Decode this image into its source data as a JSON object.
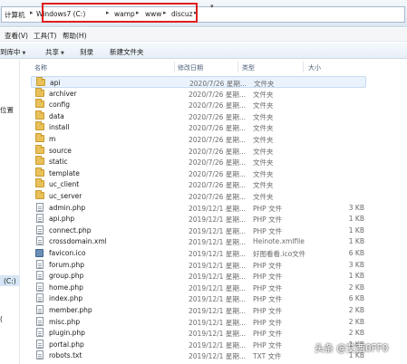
{
  "address": {
    "root": "计算机",
    "segments": [
      "Windows7 (C:)",
      "wamp",
      "www",
      "discuz"
    ]
  },
  "menu": [
    "查看(V)",
    "工具(T)",
    "帮助(H)"
  ],
  "toolbar": {
    "include": "到库中",
    "share": "共享",
    "burn": "刻录",
    "new_folder": "新建文件夹"
  },
  "sidebar": {
    "location": "位置",
    "drive": "(C:)",
    "misc": "("
  },
  "columns": {
    "name": "名称",
    "date": "修改日期",
    "type": "类型",
    "size": "大小"
  },
  "files": [
    {
      "name": "api",
      "date": "2020/7/26 星期...",
      "type": "文件夹",
      "size": "",
      "icon": "folder"
    },
    {
      "name": "archiver",
      "date": "2020/7/26 星期...",
      "type": "文件夹",
      "size": "",
      "icon": "folder"
    },
    {
      "name": "config",
      "date": "2020/7/26 星期...",
      "type": "文件夹",
      "size": "",
      "icon": "folder"
    },
    {
      "name": "data",
      "date": "2020/7/26 星期...",
      "type": "文件夹",
      "size": "",
      "icon": "folder"
    },
    {
      "name": "install",
      "date": "2020/7/26 星期...",
      "type": "文件夹",
      "size": "",
      "icon": "folder"
    },
    {
      "name": "m",
      "date": "2020/7/26 星期...",
      "type": "文件夹",
      "size": "",
      "icon": "folder"
    },
    {
      "name": "source",
      "date": "2020/7/26 星期...",
      "type": "文件夹",
      "size": "",
      "icon": "folder"
    },
    {
      "name": "static",
      "date": "2020/7/26 星期...",
      "type": "文件夹",
      "size": "",
      "icon": "folder"
    },
    {
      "name": "template",
      "date": "2020/7/26 星期...",
      "type": "文件夹",
      "size": "",
      "icon": "folder"
    },
    {
      "name": "uc_client",
      "date": "2020/7/26 星期...",
      "type": "文件夹",
      "size": "",
      "icon": "folder"
    },
    {
      "name": "uc_server",
      "date": "2020/7/26 星期...",
      "type": "文件夹",
      "size": "",
      "icon": "folder"
    },
    {
      "name": "admin.php",
      "date": "2019/12/1 星期...",
      "type": "PHP 文件",
      "size": "3 KB",
      "icon": "doc"
    },
    {
      "name": "api.php",
      "date": "2019/12/1 星期...",
      "type": "PHP 文件",
      "size": "1 KB",
      "icon": "doc"
    },
    {
      "name": "connect.php",
      "date": "2019/12/1 星期...",
      "type": "PHP 文件",
      "size": "1 KB",
      "icon": "doc"
    },
    {
      "name": "crossdomain.xml",
      "date": "2019/12/1 星期...",
      "type": "Heinote.xmlfile",
      "size": "1 KB",
      "icon": "doc"
    },
    {
      "name": "favicon.ico",
      "date": "2019/12/1 星期...",
      "type": "好图看看.ico文件",
      "size": "6 KB",
      "icon": "ico"
    },
    {
      "name": "forum.php",
      "date": "2019/12/1 星期...",
      "type": "PHP 文件",
      "size": "3 KB",
      "icon": "doc"
    },
    {
      "name": "group.php",
      "date": "2019/12/1 星期...",
      "type": "PHP 文件",
      "size": "1 KB",
      "icon": "doc"
    },
    {
      "name": "home.php",
      "date": "2019/12/1 星期...",
      "type": "PHP 文件",
      "size": "2 KB",
      "icon": "doc"
    },
    {
      "name": "index.php",
      "date": "2019/12/1 星期...",
      "type": "PHP 文件",
      "size": "6 KB",
      "icon": "doc"
    },
    {
      "name": "member.php",
      "date": "2019/12/1 星期...",
      "type": "PHP 文件",
      "size": "2 KB",
      "icon": "doc"
    },
    {
      "name": "misc.php",
      "date": "2019/12/1 星期...",
      "type": "PHP 文件",
      "size": "2 KB",
      "icon": "doc"
    },
    {
      "name": "plugin.php",
      "date": "2019/12/1 星期...",
      "type": "PHP 文件",
      "size": "2 KB",
      "icon": "doc"
    },
    {
      "name": "portal.php",
      "date": "2019/12/1 星期...",
      "type": "PHP 文件",
      "size": "1 KB",
      "icon": "doc"
    },
    {
      "name": "robots.txt",
      "date": "2019/12/1 星期...",
      "type": "TXT 文件",
      "size": "1 KB",
      "icon": "doc"
    }
  ],
  "watermark": "头条 @艾西0FF0"
}
